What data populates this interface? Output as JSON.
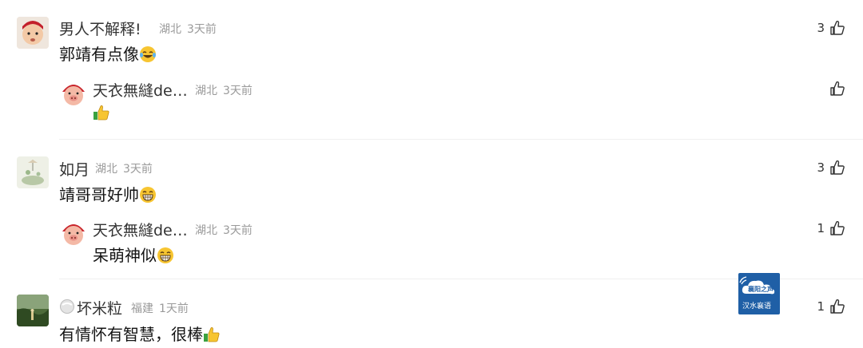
{
  "comments": [
    {
      "name": "男人不解释!",
      "location": "湖北",
      "time": "3天前",
      "text": "郭靖有点像",
      "likes": "3",
      "emoji": "laugh-cry-emoji",
      "reply": {
        "name": "天衣無縫de…",
        "location": "湖北",
        "time": "3天前",
        "text": "",
        "likes": "",
        "emoji": "thumbs-up-emoji"
      }
    },
    {
      "name": "如月",
      "location": "湖北",
      "time": "3天前",
      "text": "靖哥哥好帅",
      "likes": "3",
      "emoji": "grin-emoji",
      "reply": {
        "name": "天衣無縫de…",
        "location": "湖北",
        "time": "3天前",
        "text": "呆萌神似",
        "likes": "1",
        "emoji": "grin-emoji"
      }
    },
    {
      "name": "坏米粒",
      "location": "福建",
      "time": "1天前",
      "text": "有情怀有智慧，很棒",
      "likes": "1",
      "emoji": "thumbs-up-emoji"
    }
  ],
  "watermark": {
    "line1": "襄阳之声",
    "line2": "汉水襄语"
  },
  "colors": {
    "meta": "#9a9a9a",
    "divider": "#efefef",
    "watermark_bg": "#1f5fa6"
  }
}
